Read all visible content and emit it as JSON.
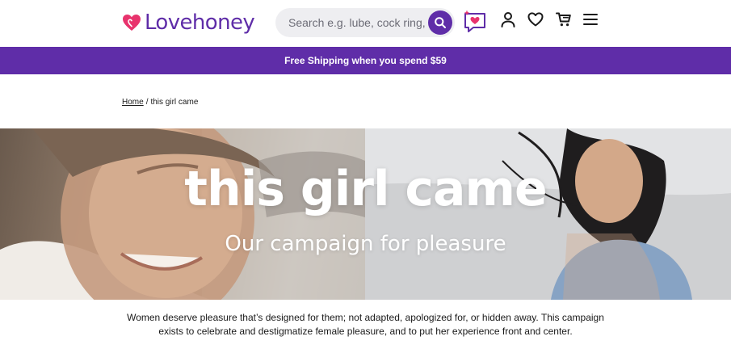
{
  "brand": {
    "name": "Lovehoney",
    "primary_color": "#5f2da8",
    "heart_color": "#e8336d"
  },
  "search": {
    "placeholder": "Search e.g. lube, cock ring,"
  },
  "header_icons": [
    "chat-heart-icon",
    "account-icon",
    "wishlist-heart-icon",
    "cart-icon",
    "menu-icon"
  ],
  "promo": {
    "text": "Free Shipping when you spend $59"
  },
  "breadcrumb": {
    "home": "Home",
    "separator": "/",
    "current": "this girl came"
  },
  "hero": {
    "title": "this girl came",
    "subtitle": "Our campaign for pleasure"
  },
  "intro": {
    "text": "Women deserve pleasure that’s designed for them; not adapted, apologized for, or hidden away. This campaign exists to celebrate and destigmatize female pleasure, and to put her experience front and center."
  }
}
